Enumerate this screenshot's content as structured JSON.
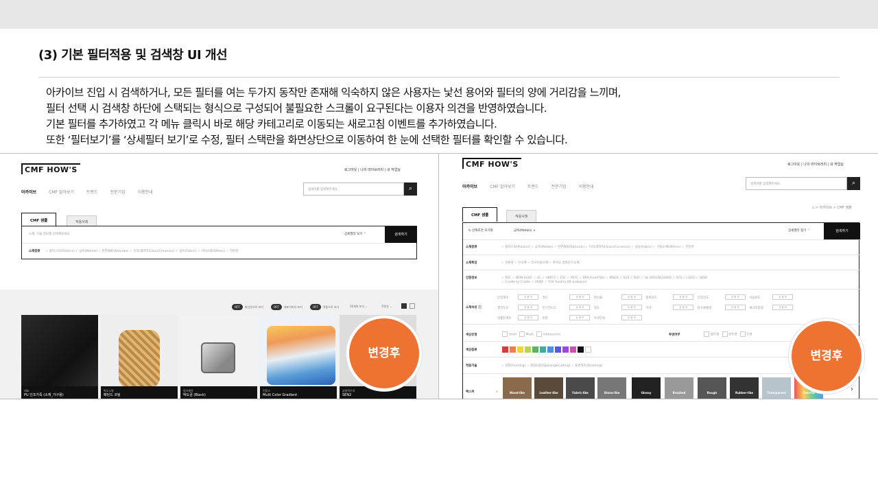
{
  "slide": {
    "title": "(3) 기본 필터적용 및 검색창 UI 개선",
    "description": [
      "아카이브 진입 시 검색하거나, 모든 필터를 여는 두가지 동작만 존재해 익숙하지 않은 사용자는 낯선 용어와 필터의 양에 거리감을 느끼며,",
      "필터 선택 시 검색창 하단에 스택되는 형식으로 구성되어 불필요한 스크롤이 요구된다는 이용자 의견을 반영하였습니다.",
      "기본 필터를 추가하였고 각 메뉴 클릭시 바로 해당 카테고리로 이동되는 새로고침 이벤트를 추가하였습니다.",
      "또한 ‘필터보기’를 ‘상세필터 보기’로 수정, 필터 스택란을 화면상단으로 이동하여 한 눈에 선택한 필터를 확인할 수 있습니다."
    ]
  },
  "left": {
    "logo": "CMF HOW'S",
    "util": "로그아웃  |  나의 라이브러리  |  내 작업실",
    "nav": [
      "아카이브",
      "CMF 알아보기",
      "트렌드",
      "전문기업",
      "이용안내"
    ],
    "header_search_placeholder": "검색어를 입력해주세요.",
    "tab_active": "CMF 샘플",
    "tab_inactive": "적용사례",
    "main_search_placeholder": "소재, 기술 정보를 검색해보세요.",
    "detail_toggle": "상세필터 보기  ⌃",
    "search_button": "검색하기",
    "filter_label": "소재종류",
    "filter_items": "✓ 플라스틱(Plastics)   ✓ 금속(Metals)   ✓ 천연재료(Naturals)   ✓ 유리/세라믹(Glass/Ceramics)   ✓ 섬유(Fabric)   ✓ 기타소재(Others)   ✓ 전문경",
    "toggles": [
      "최신순으로 보기",
      "대표이미지 보기",
      "작품으로 보기"
    ],
    "off_label": "OFF",
    "per_page": "50개씩 보기  ⌄",
    "sort": "주천순  ⌄",
    "cards": [
      {
        "cat": "대표",
        "name": "PU 인조가죽 (소재_가구용)"
      },
      {
        "cat": "박도노멀",
        "name": "패턴드 코팅"
      },
      {
        "cat": "동아제약",
        "name": "박도금 (Black)"
      },
      {
        "cat": "인탑스",
        "name": "Multi Color Gradient"
      },
      {
        "cat": "삼원적수지",
        "name": "SEN2"
      }
    ],
    "badge": "변경후"
  },
  "right": {
    "logo": "CMF HOW'S",
    "util": "로그아웃  |  나의 라이브러리  |  내 작업실",
    "nav": [
      "아카이브",
      "CMF 알아보기",
      "트렌드",
      "전문기업",
      "이용안내"
    ],
    "header_search_placeholder": "검색어를 입력해주세요.",
    "breadcrumb": "⌂  >  아카이브  >  CMF 샘플",
    "tab_active": "CMF 샘플",
    "tab_inactive": "적용사례",
    "reset": "↻ 선택조건 초기화",
    "selected_chip": "금속(Metals)  ×",
    "detail_toggle": "상세필터 접기  ⌃",
    "search_button": "검색하기",
    "rows": [
      {
        "label": "소재종류",
        "items": "✓ 플라스틱(Plastics)   ✓ 금속(Metals)   ✓ 천연재료(Naturals)   ✓ 유리/세라믹(Glass/Ceramics)   ✓ 섬유(Fabric)   ✓ 기타소재(Others)   ✓ 전문경"
      },
      {
        "label": "소재특징",
        "items": "✓ 친환경   ✓ 신소재   ✓ 리사이클소재   ✓ 바이오 컴파운드소재"
      },
      {
        "label": "인증정보",
        "items": "✓ REC   ✓ NON-SVHC   ✓ UL   ✓ HB파크   ✓ FSC   ✓ PEFC   ✓ BPA Free(FDA)   ✓ MSDS   ✓ SGS   ✓ NSF   ✓ UL GREENGUARD   ✓ SCS   ✓ LEED   ✓ SBSR"
      },
      {
        "label": "",
        "items": "✓ Cradle to Cradle   ✓ USDA   ✓ TUV Austria OK biobased"
      }
    ],
    "prop_label": "소재속성 ⓘ",
    "prop_rows": [
      [
        "인장계수",
        "경도",
        "연신율",
        "항복강도",
        "인장강도",
        "사용온도"
      ],
      [
        "열전도도",
        "전기전도도",
        "밀도",
        "가격",
        "탄소배출량",
        "에너지함량"
      ],
      [
        "영률탄계수",
        "비열",
        "투과인성"
      ]
    ],
    "chip_text": "상  중  하",
    "color_type_label": "색상유형",
    "color_types": [
      "Solid",
      "Multi",
      "Iridescence"
    ],
    "transparency_label": "투명여부",
    "transparency": [
      "불투명",
      "반투명",
      "투명"
    ],
    "color_label": "색상종류",
    "swatches": [
      "#d93a3a",
      "#f0803c",
      "#f2d33a",
      "#b7d64a",
      "#5ab45a",
      "#3aaea0",
      "#4a8fe0",
      "#5a5ad8",
      "#9a4ad8",
      "#d84ab0",
      "#111111",
      "#ffffff"
    ],
    "tech_label": "적용기술",
    "tech_items": "✓ 성형(Forming)   ✓ 결합&절삭(Joining&Cutting)   ✓ 표면처리(Finishing)",
    "texture_label": "텍스쳐",
    "textures": [
      "Wood-like",
      "Leather-like",
      "Fabric-like",
      "Stone-like",
      "Glossy",
      "Brushed",
      "Rough",
      "Rubber-like",
      "Transparent",
      "Colorful"
    ],
    "badge": "변경후"
  }
}
